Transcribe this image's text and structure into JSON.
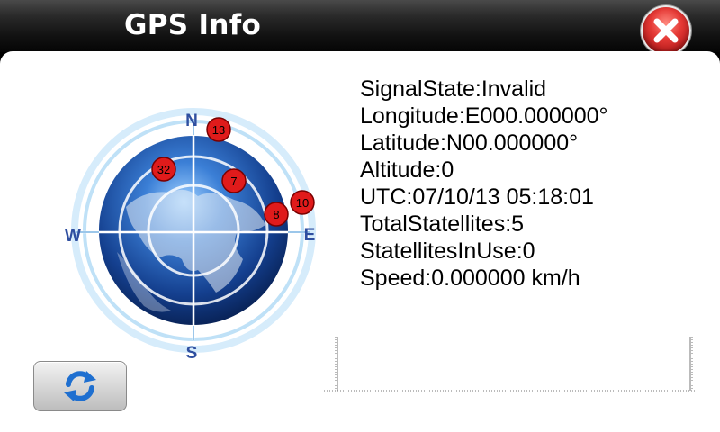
{
  "window": {
    "title": "GPS Info",
    "close_icon": "close-icon",
    "close_color": "#e53935"
  },
  "compass": {
    "north": "N",
    "south": "S",
    "east": "E",
    "west": "W",
    "ring_color": "#2f4fa0",
    "satellite_color": "#e01b1b",
    "satellites": [
      {
        "id": "13"
      },
      {
        "id": "32"
      },
      {
        "id": "7"
      },
      {
        "id": "10"
      },
      {
        "id": "8"
      }
    ]
  },
  "info": {
    "signal_state": "SignalState:Invalid",
    "longitude": "Longitude:E000.000000°",
    "latitude": "Latitude:N00.000000°",
    "altitude": "Altitude:0",
    "utc": "UTC:07/10/13 05:18:01",
    "total_satellites": "TotalStatellites:5",
    "satellites_in_use": "StatellitesInUse:0",
    "speed": "Speed:0.000000 km/h"
  },
  "refresh": {
    "icon": "refresh-icon",
    "color": "#1e6fd0"
  }
}
